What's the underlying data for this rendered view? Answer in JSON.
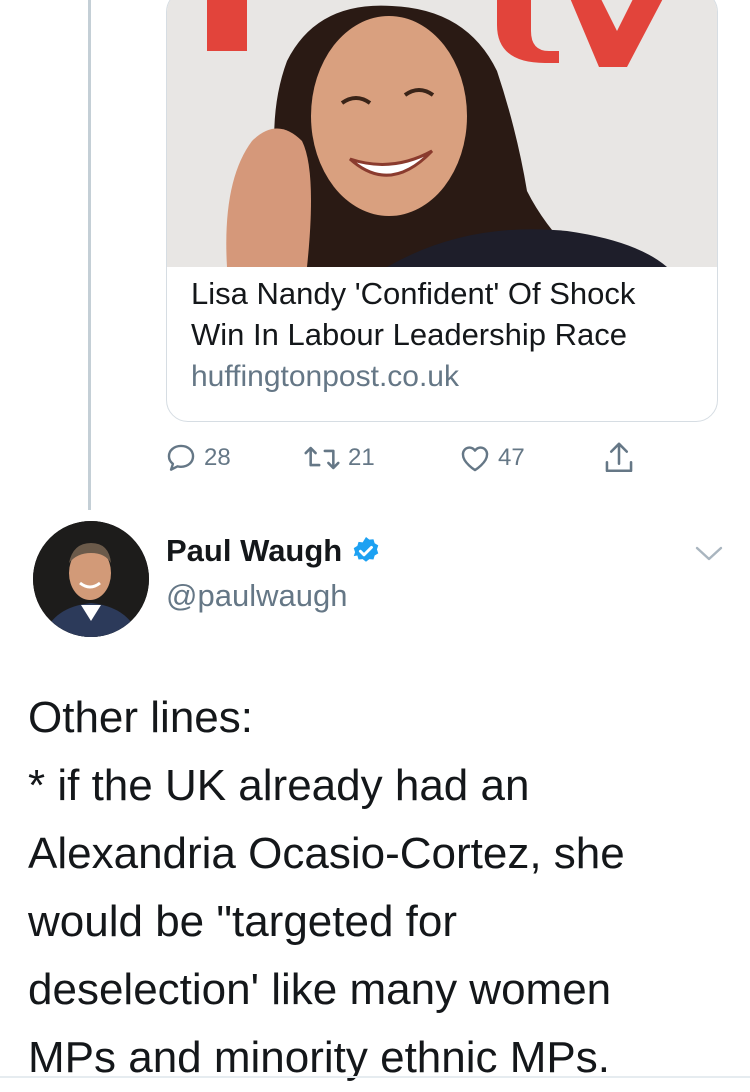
{
  "link_card": {
    "title_lines": [
      "Lisa Nandy 'Confident' Of Shock",
      "Win In Labour Leadership Race"
    ],
    "domain": "huffingtonpost.co.uk",
    "image_subject": "photo of smiling woman on phone in front of red logo"
  },
  "actions": {
    "replies": "28",
    "retweets": "21",
    "likes": "47"
  },
  "author": {
    "display_name": "Paul Waugh",
    "handle": "@paulwaugh",
    "verified": true
  },
  "tweet": {
    "lines": [
      "Other lines:",
      "* if the UK already had an",
      "Alexandria Ocasio-Cortez, she",
      "would be \"targeted for",
      "deselection' like many women",
      "MPs and minority ethnic MPs."
    ]
  },
  "colors": {
    "text": "#14171a",
    "secondary": "#657786",
    "verified": "#1da1f2",
    "border": "#d6dde3"
  }
}
